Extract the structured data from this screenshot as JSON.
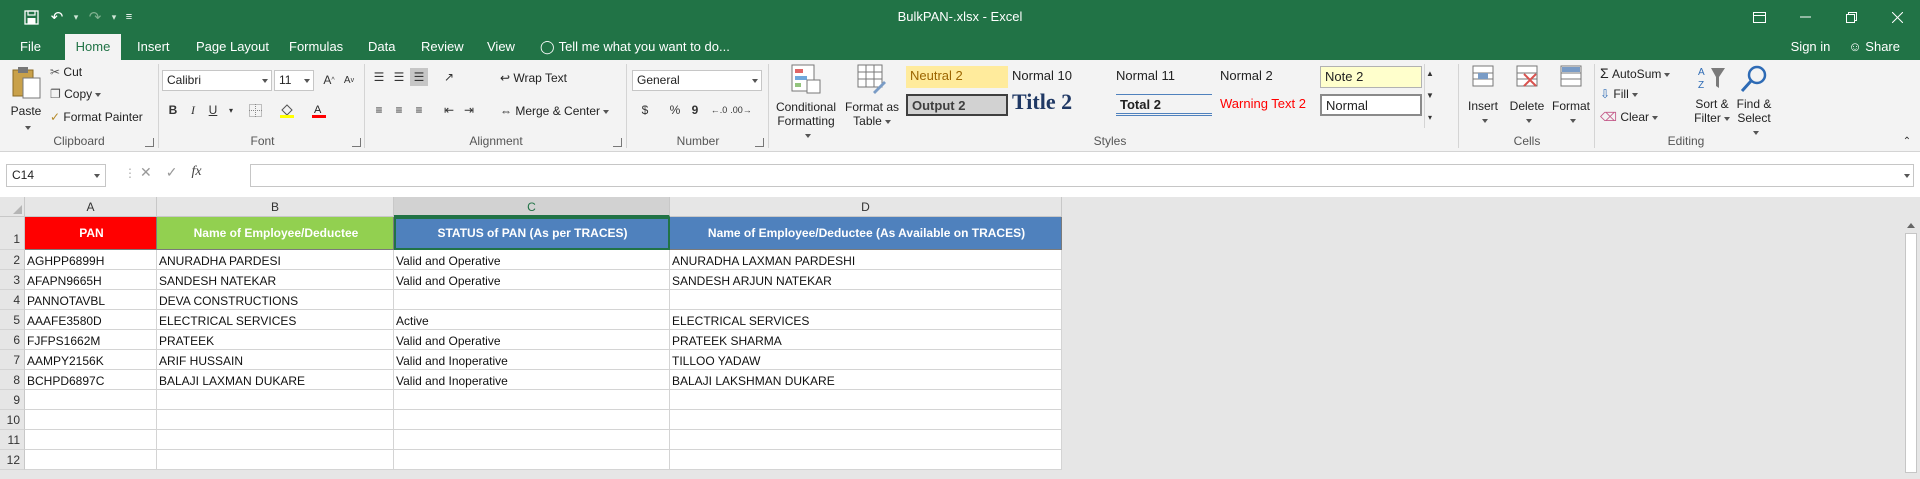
{
  "window": {
    "title": "BulkPAN-.xlsx - Excel"
  },
  "tabs": [
    {
      "label": "File"
    },
    {
      "label": "Home"
    },
    {
      "label": "Insert"
    },
    {
      "label": "Page Layout"
    },
    {
      "label": "Formulas"
    },
    {
      "label": "Data"
    },
    {
      "label": "Review"
    },
    {
      "label": "View"
    }
  ],
  "tell_me": "Tell me what you want to do...",
  "signin": "Sign in",
  "share": "Share",
  "clipboard": {
    "paste": "Paste",
    "cut": "Cut",
    "copy": "Copy",
    "format_painter": "Format Painter",
    "label": "Clipboard"
  },
  "font": {
    "name": "Calibri",
    "size": "11",
    "bold": "B",
    "italic": "I",
    "underline": "U",
    "label": "Font"
  },
  "alignment": {
    "wrap_text": "Wrap Text",
    "merge_center": "Merge & Center",
    "label": "Alignment"
  },
  "number": {
    "format": "General",
    "currency": "$",
    "percent": "%",
    "comma": "9",
    "label": "Number"
  },
  "styles": {
    "conditional_1": "Conditional",
    "conditional_2": "Formatting",
    "format_as_table_1": "Format as",
    "format_as_table_2": "Table",
    "cells": [
      {
        "label": "Neutral 2",
        "bg": "#ffeb9c",
        "fg": "#9c6500"
      },
      {
        "label": "Normal 10",
        "bg": "#f3f3f3",
        "fg": "#222222"
      },
      {
        "label": "Normal 11",
        "bg": "#f3f3f3",
        "fg": "#222222"
      },
      {
        "label": "Normal 2",
        "bg": "#f3f3f3",
        "fg": "#222222"
      },
      {
        "label": "Note 2",
        "bg": "#ffffcc",
        "fg": "#222222"
      },
      {
        "label": "Output 2",
        "bg": "#f2f2f2",
        "fg": "#3f3f3f"
      },
      {
        "label": "Title 2",
        "bg": "#f3f3f3",
        "fg": "#1f3864"
      },
      {
        "label": "Total 2",
        "bg": "#f3f3f3",
        "fg": "#222222"
      },
      {
        "label": "Warning Text 2",
        "bg": "#f3f3f3",
        "fg": "#ff0000"
      },
      {
        "label": "Normal",
        "bg": "#ffffff",
        "fg": "#222222"
      }
    ],
    "label": "Styles"
  },
  "cells_group": {
    "insert": "Insert",
    "delete": "Delete",
    "format": "Format",
    "label": "Cells"
  },
  "editing": {
    "autosum": "AutoSum",
    "fill": "Fill",
    "clear": "Clear",
    "sort_1": "Sort &",
    "sort_2": "Filter",
    "find_1": "Find &",
    "find_2": "Select",
    "label": "Editing"
  },
  "formula_bar": {
    "name_box": "C14",
    "fx": "fx",
    "value": ""
  },
  "sheet": {
    "columns": [
      "A",
      "B",
      "C",
      "D"
    ],
    "selected_column": "C",
    "header_row": [
      {
        "text": "PAN",
        "bg": "#ff0000"
      },
      {
        "text": "Name of Employee/Deductee",
        "bg": "#92d050"
      },
      {
        "text": "STATUS of PAN (As per TRACES)",
        "bg": "#4f81bd"
      },
      {
        "text": "Name of Employee/Deductee (As Available on TRACES)",
        "bg": "#4f81bd"
      }
    ],
    "rows": [
      [
        "AGHPP6899H",
        "ANURADHA PARDESI",
        "Valid and Operative",
        "ANURADHA LAXMAN PARDESHI"
      ],
      [
        "AFAPN9665H",
        "SANDESH NATEKAR",
        "Valid and Operative",
        "SANDESH ARJUN NATEKAR"
      ],
      [
        "PANNOTAVBL",
        "DEVA CONSTRUCTIONS",
        "",
        ""
      ],
      [
        "AAAFE3580D",
        "ELECTRICAL SERVICES",
        "Active",
        "ELECTRICAL SERVICES"
      ],
      [
        "FJFPS1662M",
        "PRATEEK",
        "Valid and Operative",
        "PRATEEK SHARMA"
      ],
      [
        "AAMPY2156K",
        "ARIF HUSSAIN",
        "Valid and Inoperative",
        "TILLOO YADAW"
      ],
      [
        "BCHPD6897C",
        "BALAJI LAXMAN DUKARE",
        "Valid and Inoperative",
        "BALAJI LAKSHMAN DUKARE"
      ],
      [
        "",
        "",
        "",
        ""
      ],
      [
        "",
        "",
        "",
        ""
      ],
      [
        "",
        "",
        "",
        ""
      ],
      [
        "",
        "",
        "",
        ""
      ]
    ],
    "row_numbers": [
      "1",
      "2",
      "3",
      "4",
      "5",
      "6",
      "7",
      "8",
      "9",
      "10",
      "11",
      "12"
    ]
  }
}
